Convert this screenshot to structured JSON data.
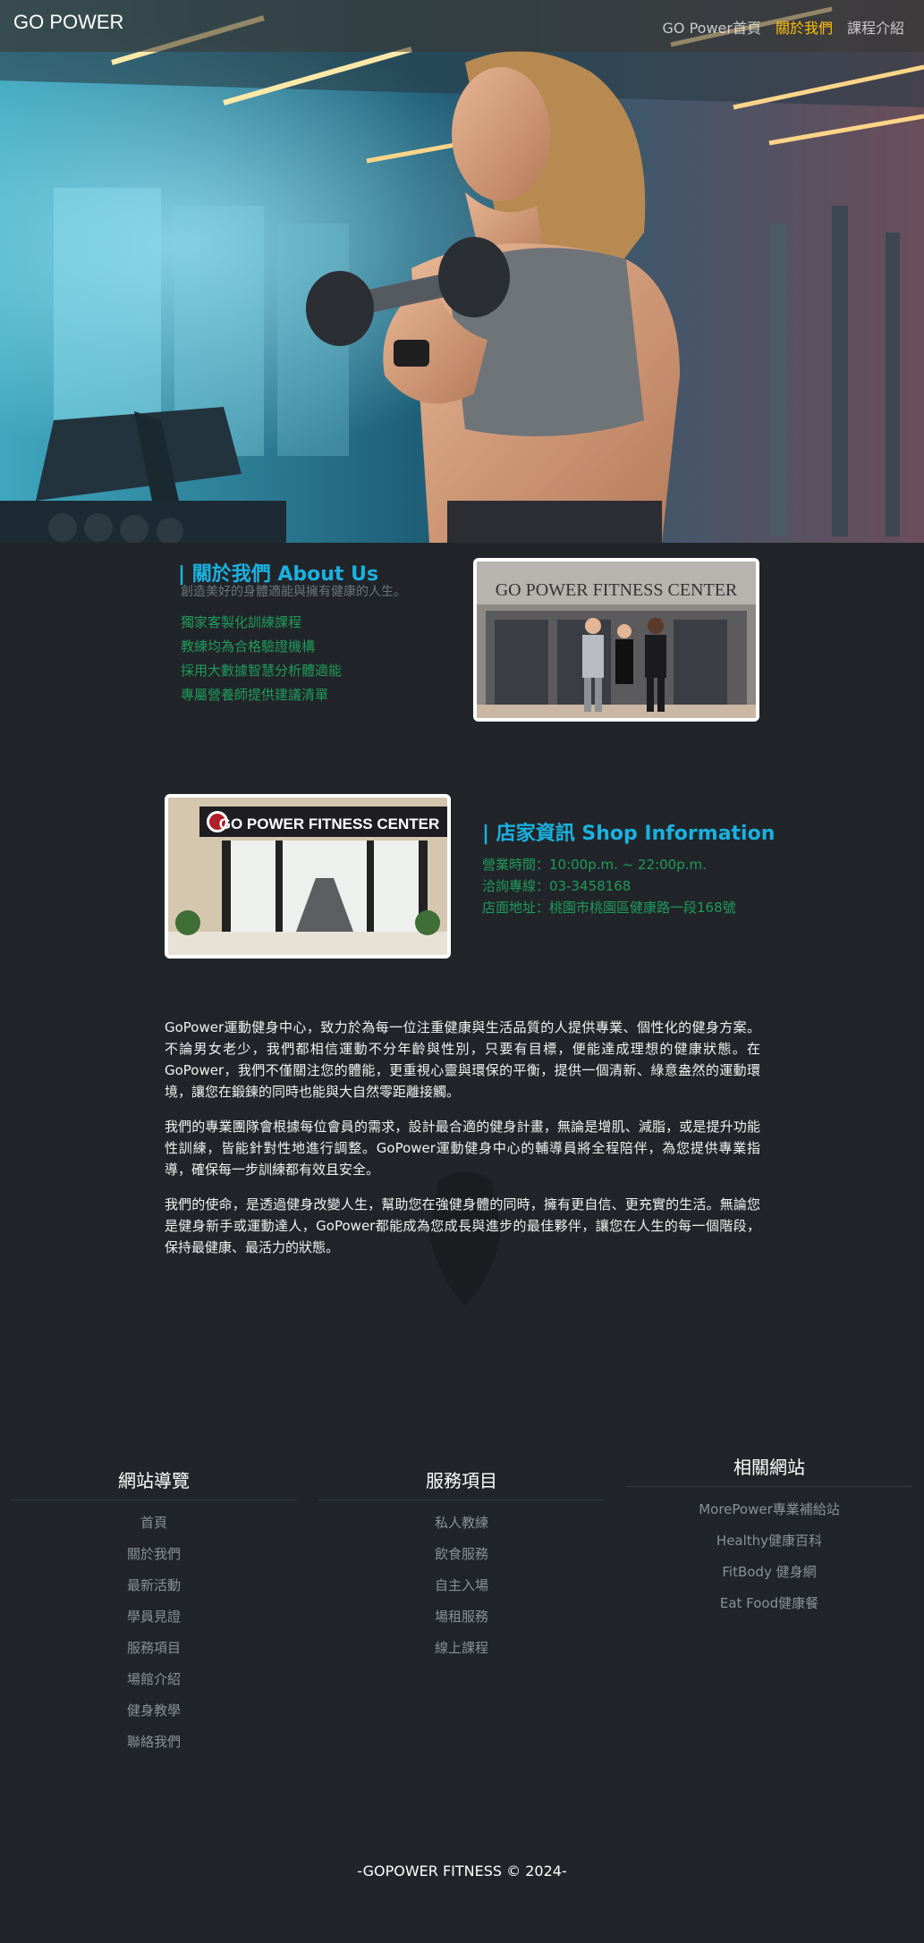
{
  "navbar": {
    "brand": "GO POWER",
    "links": [
      {
        "label": "GO Power首頁"
      },
      {
        "label": "關於我們"
      },
      {
        "label": "課程介紹"
      }
    ]
  },
  "about": {
    "title": "| 關於我們 About Us",
    "subtitle": "創造美好的身體適能與擁有健康的人生。",
    "features": [
      "獨家客製化訓練課程",
      "教練均為合格驗證機構",
      "採用大數據智慧分析體適能",
      "專屬營養師提供建議清單"
    ],
    "image_sign": "GO POWER FITNESS CENTER"
  },
  "shop": {
    "title": "| 店家資訊 Shop Information",
    "hours": "營業時間：10:00p.m. ~ 22:00p.m.",
    "phone": "洽詢專線：03-3458168",
    "address": "店面地址：桃園市桃園區健康路一段168號",
    "image_sign": "GO POWER FITNESS CENTER"
  },
  "description": [
    "GoPower運動健身中心，致力於為每一位注重健康與生活品質的人提供專業、個性化的健身方案。不論男女老少，我們都相信運動不分年齡與性別，只要有目標，便能達成理想的健康狀態。在GoPower，我們不僅關注您的體能，更重視心靈與環保的平衡，提供一個清新、綠意盎然的運動環境，讓您在鍛鍊的同時也能與大自然零距離接觸。",
    "我們的專業團隊會根據每位會員的需求，設計最合適的健身計畫，無論是增肌、減脂，或是提升功能性訓練，皆能針對性地進行調整。GoPower運動健身中心的輔導員將全程陪伴，為您提供專業指導，確保每一步訓練都有效且安全。",
    "我們的使命，是透過健身改變人生，幫助您在強健身體的同時，擁有更自信、更充實的生活。無論您是健身新手或運動達人，GoPower都能成為您成長與進步的最佳夥伴，讓您在人生的每一個階段，保持最健康、最活力的狀態。"
  ],
  "footer": {
    "nav": {
      "title": "網站導覽",
      "items": [
        "首頁",
        "關於我們",
        "最新活動",
        "學員見證",
        "服務項目",
        "場館介紹",
        "健身教學",
        "聯絡我們"
      ]
    },
    "services": {
      "title": "服務項目",
      "items": [
        "私人教練",
        "飲食服務",
        "自主入場",
        "場租服務",
        "線上課程"
      ]
    },
    "related": {
      "title": "相關網站",
      "items": [
        "MorePower專業補給站",
        "Healthy健康百科",
        "FitBody 健身網",
        "Eat Food健康餐"
      ]
    },
    "copyright": "-GOPOWER FITNESS © 2024-"
  },
  "colors": {
    "accent_blue": "#1ab1e0",
    "list_green": "#1f9b5b",
    "active_nav": "#ffc107",
    "background": "#212529"
  }
}
